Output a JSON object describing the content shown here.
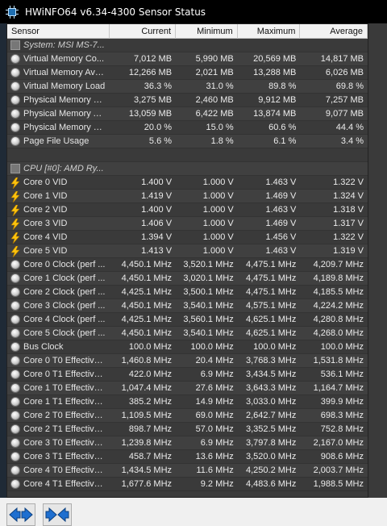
{
  "window": {
    "title": "HWiNFO64 v6.34-4300 Sensor Status"
  },
  "columns": [
    "Sensor",
    "Current",
    "Minimum",
    "Maximum",
    "Average"
  ],
  "rows": [
    {
      "type": "group",
      "icon": "chip-icon",
      "label": "System: MSI MS-7...",
      "cur": "",
      "min": "",
      "max": "",
      "avg": ""
    },
    {
      "type": "item",
      "icon": "gauge-icon",
      "label": "Virtual Memory Co...",
      "cur": "7,012 MB",
      "min": "5,990 MB",
      "max": "20,569 MB",
      "avg": "14,817 MB"
    },
    {
      "type": "item",
      "icon": "gauge-icon",
      "label": "Virtual Memory Ava...",
      "cur": "12,266 MB",
      "min": "2,021 MB",
      "max": "13,288 MB",
      "avg": "6,026 MB"
    },
    {
      "type": "item",
      "icon": "gauge-icon",
      "label": "Virtual Memory Load",
      "cur": "36.3 %",
      "min": "31.0 %",
      "max": "89.8 %",
      "avg": "69.8 %"
    },
    {
      "type": "item",
      "icon": "gauge-icon",
      "label": "Physical Memory U...",
      "cur": "3,275 MB",
      "min": "2,460 MB",
      "max": "9,912 MB",
      "avg": "7,257 MB"
    },
    {
      "type": "item",
      "icon": "gauge-icon",
      "label": "Physical Memory A...",
      "cur": "13,059 MB",
      "min": "6,422 MB",
      "max": "13,874 MB",
      "avg": "9,077 MB"
    },
    {
      "type": "item",
      "icon": "gauge-icon",
      "label": "Physical Memory Load",
      "cur": "20.0 %",
      "min": "15.0 %",
      "max": "60.6 %",
      "avg": "44.4 %"
    },
    {
      "type": "item",
      "icon": "gauge-icon",
      "label": "Page File Usage",
      "cur": "5.6 %",
      "min": "1.8 %",
      "max": "6.1 %",
      "avg": "3.4 %"
    },
    {
      "type": "blank",
      "icon": "",
      "label": "",
      "cur": "",
      "min": "",
      "max": "",
      "avg": ""
    },
    {
      "type": "group",
      "icon": "chip-icon",
      "label": "CPU [#0]: AMD Ry...",
      "cur": "",
      "min": "",
      "max": "",
      "avg": ""
    },
    {
      "type": "item",
      "icon": "bolt-icon",
      "label": "Core 0 VID",
      "cur": "1.400 V",
      "min": "1.000 V",
      "max": "1.463 V",
      "avg": "1.322 V"
    },
    {
      "type": "item",
      "icon": "bolt-icon",
      "label": "Core 1 VID",
      "cur": "1.419 V",
      "min": "1.000 V",
      "max": "1.469 V",
      "avg": "1.324 V"
    },
    {
      "type": "item",
      "icon": "bolt-icon",
      "label": "Core 2 VID",
      "cur": "1.400 V",
      "min": "1.000 V",
      "max": "1.463 V",
      "avg": "1.318 V"
    },
    {
      "type": "item",
      "icon": "bolt-icon",
      "label": "Core 3 VID",
      "cur": "1.406 V",
      "min": "1.000 V",
      "max": "1.469 V",
      "avg": "1.317 V"
    },
    {
      "type": "item",
      "icon": "bolt-icon",
      "label": "Core 4 VID",
      "cur": "1.394 V",
      "min": "1.000 V",
      "max": "1.456 V",
      "avg": "1.322 V"
    },
    {
      "type": "item",
      "icon": "bolt-icon",
      "label": "Core 5 VID",
      "cur": "1.413 V",
      "min": "1.000 V",
      "max": "1.463 V",
      "avg": "1.319 V"
    },
    {
      "type": "item",
      "icon": "gauge-icon",
      "label": "Core 0 Clock (perf ...",
      "cur": "4,450.1 MHz",
      "min": "3,520.1 MHz",
      "max": "4,475.1 MHz",
      "avg": "4,209.7 MHz"
    },
    {
      "type": "item",
      "icon": "gauge-icon",
      "label": "Core 1 Clock (perf ...",
      "cur": "4,450.1 MHz",
      "min": "3,020.1 MHz",
      "max": "4,475.1 MHz",
      "avg": "4,189.8 MHz"
    },
    {
      "type": "item",
      "icon": "gauge-icon",
      "label": "Core 2 Clock (perf ...",
      "cur": "4,425.1 MHz",
      "min": "3,500.1 MHz",
      "max": "4,475.1 MHz",
      "avg": "4,185.5 MHz"
    },
    {
      "type": "item",
      "icon": "gauge-icon",
      "label": "Core 3 Clock (perf ...",
      "cur": "4,450.1 MHz",
      "min": "3,540.1 MHz",
      "max": "4,575.1 MHz",
      "avg": "4,224.2 MHz"
    },
    {
      "type": "item",
      "icon": "gauge-icon",
      "label": "Core 4 Clock (perf ...",
      "cur": "4,425.1 MHz",
      "min": "3,560.1 MHz",
      "max": "4,625.1 MHz",
      "avg": "4,280.8 MHz"
    },
    {
      "type": "item",
      "icon": "gauge-icon",
      "label": "Core 5 Clock (perf ...",
      "cur": "4,450.1 MHz",
      "min": "3,540.1 MHz",
      "max": "4,625.1 MHz",
      "avg": "4,268.0 MHz"
    },
    {
      "type": "item",
      "icon": "gauge-icon",
      "label": "Bus Clock",
      "cur": "100.0 MHz",
      "min": "100.0 MHz",
      "max": "100.0 MHz",
      "avg": "100.0 MHz"
    },
    {
      "type": "item",
      "icon": "gauge-icon",
      "label": "Core 0 T0 Effective...",
      "cur": "1,460.8 MHz",
      "min": "20.4 MHz",
      "max": "3,768.3 MHz",
      "avg": "1,531.8 MHz"
    },
    {
      "type": "item",
      "icon": "gauge-icon",
      "label": "Core 0 T1 Effective...",
      "cur": "422.0 MHz",
      "min": "6.9 MHz",
      "max": "3,434.5 MHz",
      "avg": "536.1 MHz"
    },
    {
      "type": "item",
      "icon": "gauge-icon",
      "label": "Core 1 T0 Effective...",
      "cur": "1,047.4 MHz",
      "min": "27.6 MHz",
      "max": "3,643.3 MHz",
      "avg": "1,164.7 MHz"
    },
    {
      "type": "item",
      "icon": "gauge-icon",
      "label": "Core 1 T1 Effective...",
      "cur": "385.2 MHz",
      "min": "14.9 MHz",
      "max": "3,033.0 MHz",
      "avg": "399.9 MHz"
    },
    {
      "type": "item",
      "icon": "gauge-icon",
      "label": "Core 2 T0 Effective...",
      "cur": "1,109.5 MHz",
      "min": "69.0 MHz",
      "max": "2,642.7 MHz",
      "avg": "698.3 MHz"
    },
    {
      "type": "item",
      "icon": "gauge-icon",
      "label": "Core 2 T1 Effective...",
      "cur": "898.7 MHz",
      "min": "57.0 MHz",
      "max": "3,352.5 MHz",
      "avg": "752.8 MHz"
    },
    {
      "type": "item",
      "icon": "gauge-icon",
      "label": "Core 3 T0 Effective...",
      "cur": "1,239.8 MHz",
      "min": "6.9 MHz",
      "max": "3,797.8 MHz",
      "avg": "2,167.0 MHz"
    },
    {
      "type": "item",
      "icon": "gauge-icon",
      "label": "Core 3 T1 Effective...",
      "cur": "458.7 MHz",
      "min": "13.6 MHz",
      "max": "3,520.0 MHz",
      "avg": "908.6 MHz"
    },
    {
      "type": "item",
      "icon": "gauge-icon",
      "label": "Core 4 T0 Effective...",
      "cur": "1,434.5 MHz",
      "min": "11.6 MHz",
      "max": "4,250.2 MHz",
      "avg": "2,003.7 MHz"
    },
    {
      "type": "item",
      "icon": "gauge-icon",
      "label": "Core 4 T1 Effective...",
      "cur": "1,677.6 MHz",
      "min": "9.2 MHz",
      "max": "4,483.6 MHz",
      "avg": "1,988.5 MHz"
    }
  ],
  "toolbar": {
    "nav_prev_icon": "double-arrow-icon",
    "nav_next_icon": "double-arrow-alt-icon"
  },
  "colors": {
    "accent": "#1f6fb2",
    "panel_bg": "#3c3c3c",
    "bolt": "#ffc40d"
  }
}
